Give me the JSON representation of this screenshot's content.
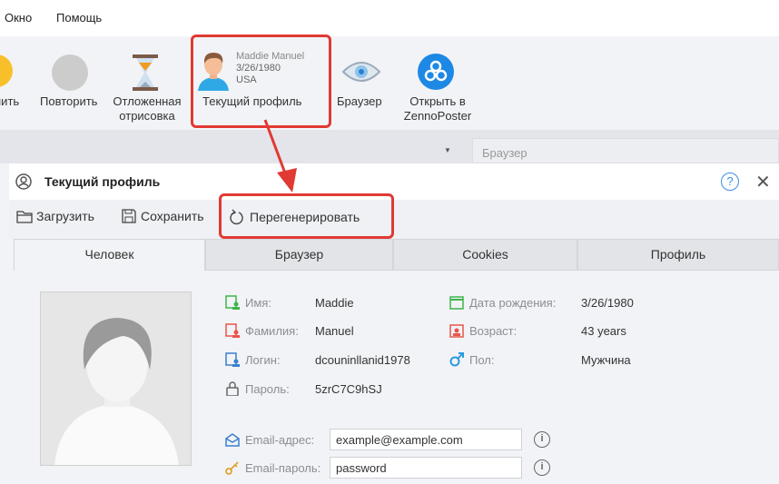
{
  "menu": {
    "items": [
      "Окно",
      "Помощь"
    ]
  },
  "toolbar": {
    "partial_label": "нить",
    "repeat": "Повторить",
    "deferred_line1": "Отложенная",
    "deferred_line2": "отрисовка",
    "profile": {
      "name": "Maddie Manuel",
      "dob": "3/26/1980",
      "country": "USA",
      "label": "Текущий профиль"
    },
    "browser": "Браузер",
    "open_line1": "Открыть в",
    "open_line2": "ZennoPoster"
  },
  "band": {
    "browser_field": "Браузер"
  },
  "panel": {
    "title": "Текущий профиль",
    "load": "Загрузить",
    "save": "Сохранить",
    "regenerate": "Перегенерировать",
    "tabs": [
      "Человек",
      "Браузер",
      "Cookies",
      "Профиль"
    ],
    "fields": {
      "first_name_label": "Имя:",
      "first_name": "Maddie",
      "last_name_label": "Фамилия:",
      "last_name": "Manuel",
      "login_label": "Логин:",
      "login": "dcouninllanid1978",
      "password_label": "Пароль:",
      "password": "5zrC7C9hSJ",
      "dob_label": "Дата рождения:",
      "dob": "3/26/1980",
      "age_label": "Возраст:",
      "age": "43 years",
      "sex_label": "Пол:",
      "sex": "Мужчина",
      "email_label": "Email-адрес:",
      "email": "example@example.com",
      "email_pass_label": "Email-пароль:",
      "email_pass": "password"
    }
  },
  "colors": {
    "accent_red": "#e03a33",
    "blue": "#1e88e5"
  }
}
